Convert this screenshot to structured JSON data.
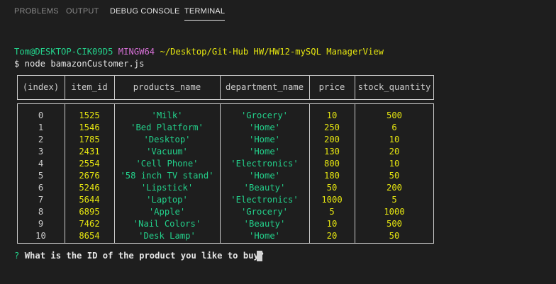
{
  "tabs": [
    {
      "label": "PROBLEMS"
    },
    {
      "label": "OUTPUT"
    },
    {
      "label": "DEBUG CONSOLE"
    },
    {
      "label": "TERMINAL"
    }
  ],
  "prompt": {
    "user_host": "Tom@DESKTOP-CIK09D5",
    "env": "MINGW64",
    "path": "~/Desktop/Git-Hub HW/HW12-mySQL ManagerView",
    "command": "$ node bamazonCustomer.js"
  },
  "table": {
    "headers": [
      "(index)",
      "item_id",
      "products_name",
      "department_name",
      "price",
      "stock_quantity"
    ],
    "rows": [
      [
        "0",
        "1525",
        "'Milk'",
        "'Grocery'",
        "10",
        "500"
      ],
      [
        "1",
        "1546",
        "'Bed Platform'",
        "'Home'",
        "250",
        "6"
      ],
      [
        "2",
        "1785",
        "'Desktop'",
        "'Home'",
        "200",
        "10"
      ],
      [
        "3",
        "2431",
        "'Vacuum'",
        "'Home'",
        "130",
        "20"
      ],
      [
        "4",
        "2554",
        "'Cell Phone'",
        "'Electronics'",
        "800",
        "10"
      ],
      [
        "5",
        "2676",
        "'58 inch TV stand'",
        "'Home'",
        "180",
        "50"
      ],
      [
        "6",
        "5246",
        "'Lipstick'",
        "'Beauty'",
        "50",
        "200"
      ],
      [
        "7",
        "5644",
        "'Laptop'",
        "'Electronics'",
        "1000",
        "5"
      ],
      [
        "8",
        "6895",
        "'Apple'",
        "'Grocery'",
        "5",
        "1000"
      ],
      [
        "9",
        "7462",
        "'Nail Colors'",
        "'Beauty'",
        "10",
        "500"
      ],
      [
        "10",
        "8654",
        "'Desk Lamp'",
        "'Home'",
        "20",
        "50"
      ]
    ]
  },
  "question": {
    "marker": "?",
    "text": "What is the ID of the product you like to buy?"
  },
  "colors": {
    "background": "#1e1e1e",
    "green": "#23d18b",
    "magenta": "#d670d6",
    "yellow": "#e5e510"
  }
}
